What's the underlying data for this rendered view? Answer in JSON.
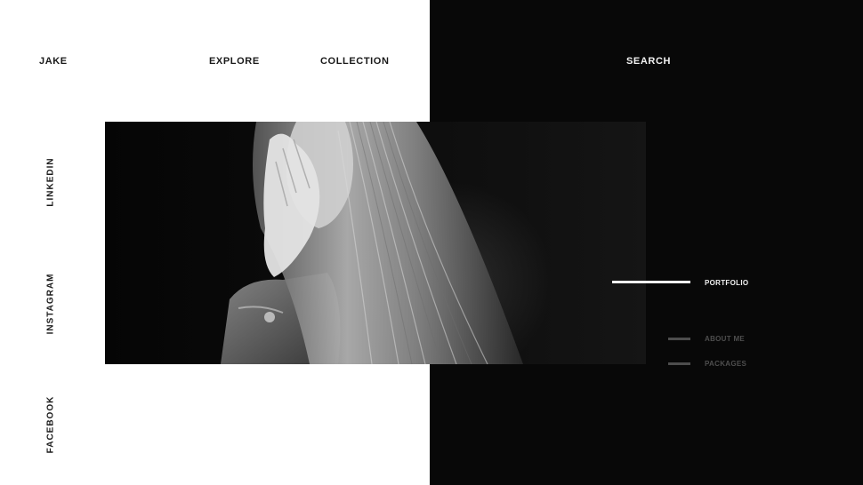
{
  "header": {
    "brand": "JAKE",
    "nav": [
      {
        "label": "EXPLORE"
      },
      {
        "label": "COLLECTION"
      },
      {
        "label": "SEARCH"
      }
    ]
  },
  "social": [
    {
      "label": "LINKEDIN"
    },
    {
      "label": "INSTAGRAM"
    },
    {
      "label": "FACEBOOK"
    }
  ],
  "side_menu": {
    "items": [
      {
        "label": "PORTFOLIO",
        "active": true
      },
      {
        "label": "ABOUT ME",
        "active": false
      },
      {
        "label": "PACKAGES",
        "active": false
      }
    ]
  },
  "colors": {
    "background": "#ffffff",
    "dark_panel": "#080808",
    "active": "#f5f5f5",
    "inactive": "#4d4d4d"
  }
}
